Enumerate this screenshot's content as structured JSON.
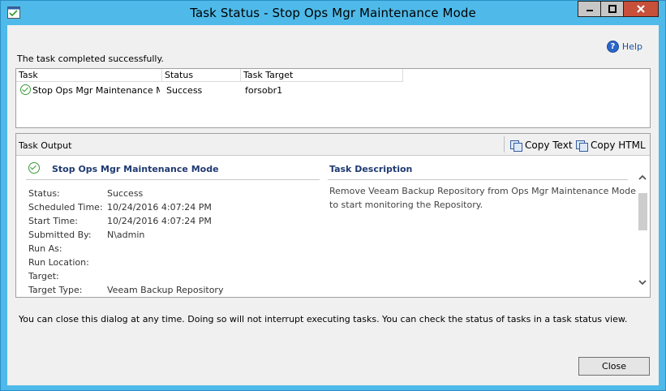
{
  "window": {
    "title": "Task Status - Stop Ops Mgr Maintenance Mode"
  },
  "help": {
    "label": "Help"
  },
  "status_message": "The task completed successfully.",
  "task_list": {
    "columns": [
      "Task",
      "Status",
      "Task Target"
    ],
    "rows": [
      {
        "task": "Stop Ops Mgr Maintenance M...",
        "status": "Success",
        "target": "forsobr1"
      }
    ]
  },
  "output": {
    "title": "Task Output",
    "copy_text": "Copy Text",
    "copy_html": "Copy HTML",
    "task_name": "Stop Ops Mgr Maintenance Mode",
    "description_header": "Task Description",
    "description": "Remove Veeam Backup Repository from Ops Mgr Maintenance Mode to start monitoring the Repository.",
    "properties": [
      {
        "label": "Status:",
        "value": "Success"
      },
      {
        "label": "Scheduled Time:",
        "value": "10/24/2016 4:07:24 PM"
      },
      {
        "label": "Start Time:",
        "value": "10/24/2016 4:07:24 PM"
      },
      {
        "label": "Submitted By:",
        "value": "N\\admin"
      },
      {
        "label": "Run As:",
        "value": ""
      },
      {
        "label": "Run Location:",
        "value": ""
      },
      {
        "label": "Target:",
        "value": ""
      },
      {
        "label": "Target Type:",
        "value": "Veeam Backup Repository"
      }
    ]
  },
  "footer_message": "You can close this dialog at any time. Doing so will not interrupt executing tasks. You can check the status of tasks in a task status view.",
  "buttons": {
    "close": "Close"
  },
  "colors": {
    "titlebar": "#4fbae9",
    "close_button": "#c7503b",
    "header_text": "#1f3a72",
    "success_green": "#3a9a3a"
  }
}
